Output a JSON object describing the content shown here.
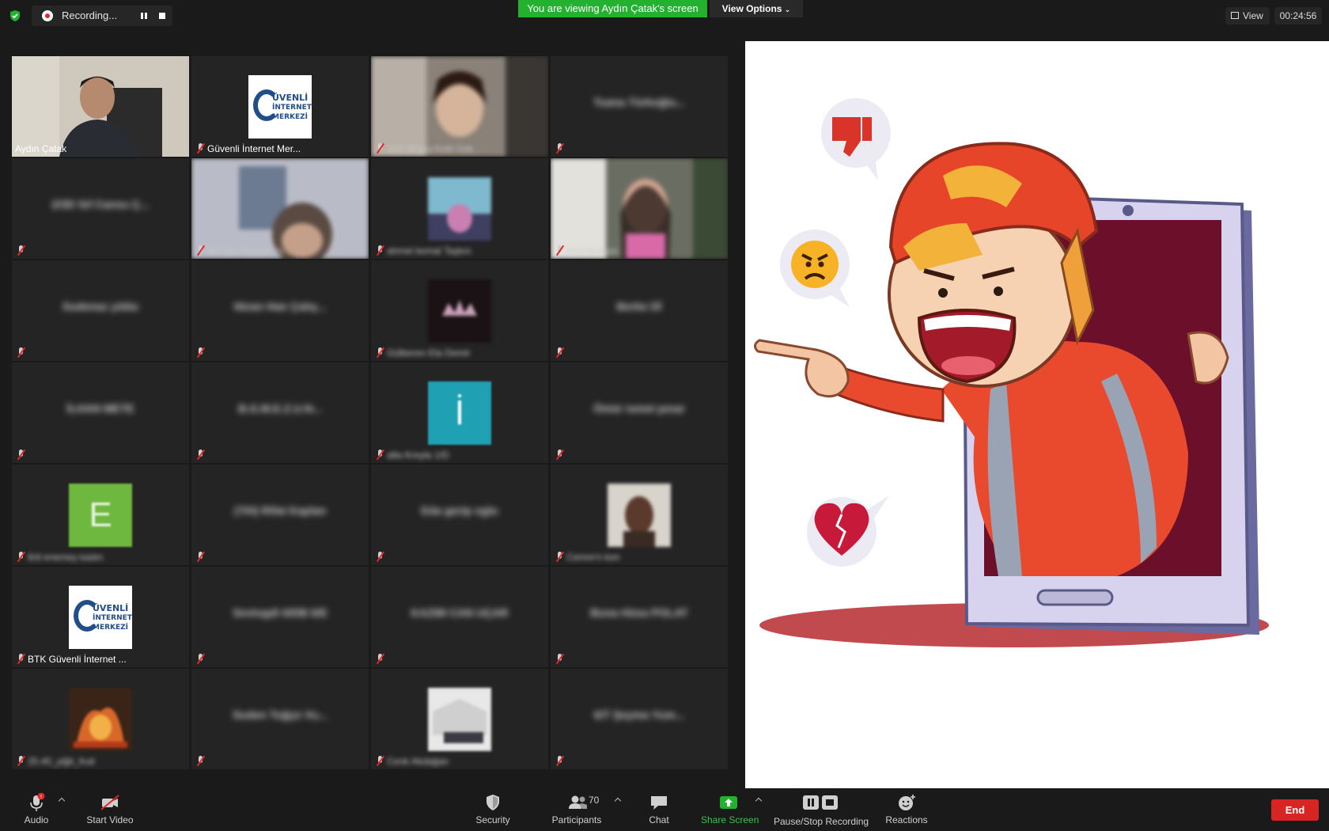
{
  "topbar": {
    "recording_label": "Recording...",
    "viewing_banner": "You are viewing Aydın Çatak's screen",
    "view_options_label": "View Options",
    "view_label": "View",
    "timer": "00:24:56"
  },
  "gallery": {
    "tiles": [
      {
        "name": "Aydın Çatak"
      },
      {
        "name": "Güvenli İnternet Mer..."
      },
      {
        "name": "2/11 Büşra Kotil Gök..."
      },
      {
        "name": "Tuana Türkoğlu..."
      },
      {
        "name": "2/3D Sıf Cansu Ç..."
      },
      {
        "name": "4/C Ela Yerşen Ya..."
      },
      {
        "name": "ahmet kemal Taşkın"
      },
      {
        "name": "Nisa Bulgun"
      },
      {
        "name": "Sudenaz yıldız"
      },
      {
        "name": "Nizan Han Çalış..."
      },
      {
        "name": "Gülberen Ela Demir"
      },
      {
        "name": "Berke Dİ"
      },
      {
        "name": "İLHAN METE"
      },
      {
        "name": "B.G.M.E.Z.U.N..."
      },
      {
        "name": "alta Kreyla 1/D"
      },
      {
        "name": "Ömür ismet pınar"
      },
      {
        "name": "6/d enemey kadın"
      },
      {
        "name": "(7/H) Rifat Kaplan"
      },
      {
        "name": "Eda gerip oglu"
      },
      {
        "name": "Cemre'n kon"
      },
      {
        "name": "BTK Güvenli İnternet ..."
      },
      {
        "name": "Sevtogdi 6/DB 6/E"
      },
      {
        "name": "KAZIM CAN UÇAR"
      },
      {
        "name": "Buna Hüsa POLAT"
      },
      {
        "name": "25.40_yiğit_fruit"
      },
      {
        "name": "Suden Tuğçe Vu..."
      },
      {
        "name": "Cenk Akdağan"
      },
      {
        "name": "6/T Şeyma Yum..."
      }
    ],
    "avatar_letters": {
      "i_tile": "İ",
      "e_tile": "E"
    },
    "logo_text": {
      "line1": "ÜVENLİ",
      "line2": "İNTERNET",
      "line3": "MERKEZİ"
    }
  },
  "toolbar": {
    "audio": "Audio",
    "start_video": "Start Video",
    "security": "Security",
    "participants": "Participants",
    "participants_count": "70",
    "chat": "Chat",
    "share_screen": "Share Screen",
    "pause_stop_recording": "Pause/Stop Recording",
    "reactions": "Reactions",
    "end": "End"
  },
  "colors": {
    "accent_green": "#23b230",
    "end_red": "#d92424",
    "active_speaker": "#d7f36a"
  }
}
